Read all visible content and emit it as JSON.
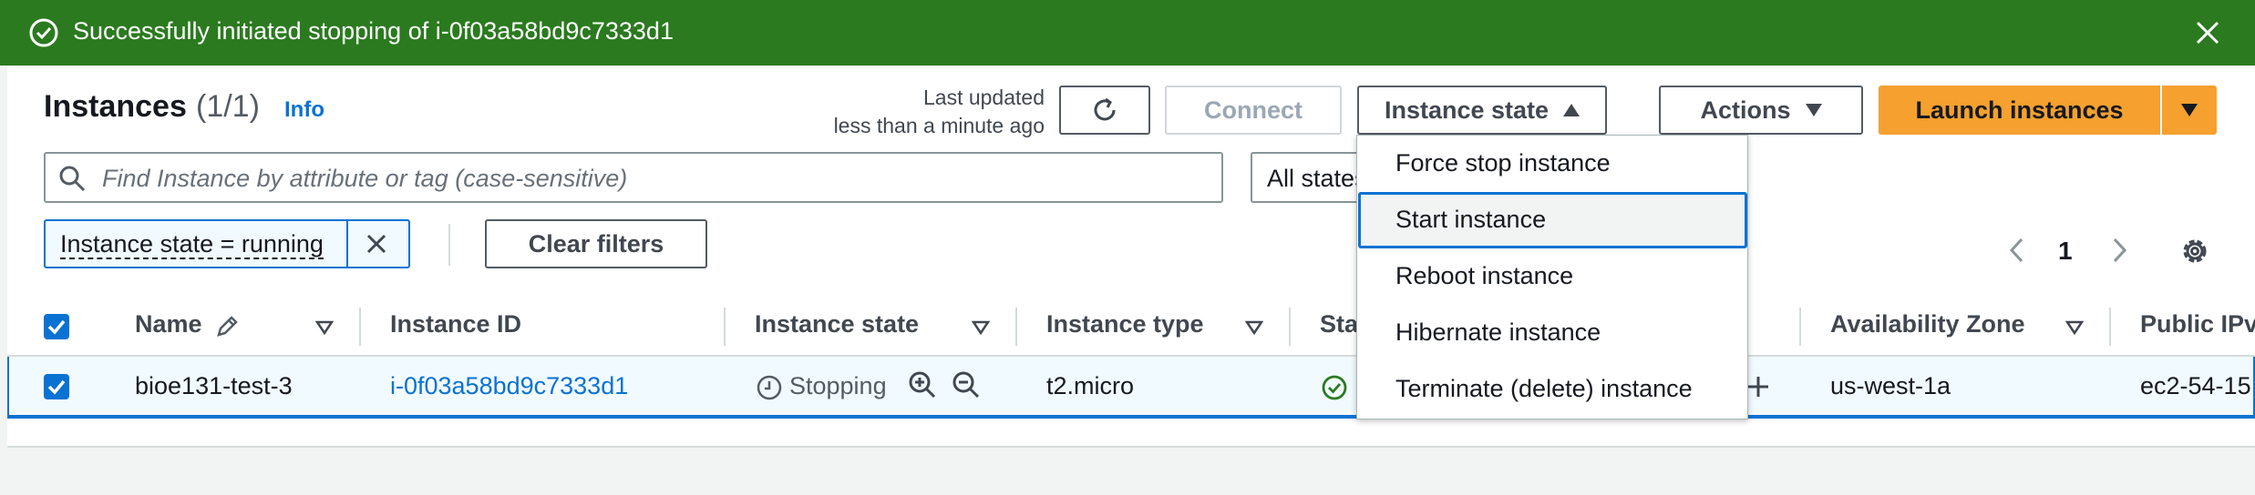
{
  "flash": {
    "message": "Successfully initiated stopping of i-0f03a58bd9c7333d1",
    "color": "#2b7a1f"
  },
  "header": {
    "title": "Instances",
    "count": "(1/1)",
    "info": "Info",
    "last_updated_line1": "Last updated",
    "last_updated_line2": "less than a minute ago"
  },
  "toolbar": {
    "connect": "Connect",
    "instance_state": "Instance state",
    "actions": "Actions",
    "launch": "Launch instances"
  },
  "search": {
    "placeholder": "Find Instance by attribute or tag (case-sensitive)"
  },
  "states_filter": {
    "value": "All states"
  },
  "filters": {
    "token": "Instance state = running",
    "clear": "Clear filters"
  },
  "pagination": {
    "current": "1"
  },
  "columns": {
    "name": "Name",
    "instance_id": "Instance ID",
    "instance_state": "Instance state",
    "instance_type": "Instance type",
    "status_check": "Sta",
    "availability_zone": "Availability Zone",
    "public_ipv4": "Public IPv"
  },
  "rows": [
    {
      "name": "bioe131-test-3",
      "instance_id": "i-0f03a58bd9c7333d1",
      "state": "Stopping",
      "type": "t2.micro",
      "zone": "us-west-1a",
      "public_dns": "ec2-54-15"
    }
  ],
  "dropdown": {
    "items": [
      "Force stop instance",
      "Start instance",
      "Reboot instance",
      "Hibernate instance",
      "Terminate (delete) instance"
    ],
    "highlighted": "Start instance"
  },
  "icons": {
    "flash": "success-check-circle-icon",
    "close": "close-icon",
    "refresh": "refresh-icon",
    "search": "search-icon",
    "settings": "gear-icon",
    "edit": "pencil-icon"
  },
  "colors": {
    "accent": "#0972d3",
    "launch": "#f5a02f",
    "success": "#2b7a1f"
  }
}
